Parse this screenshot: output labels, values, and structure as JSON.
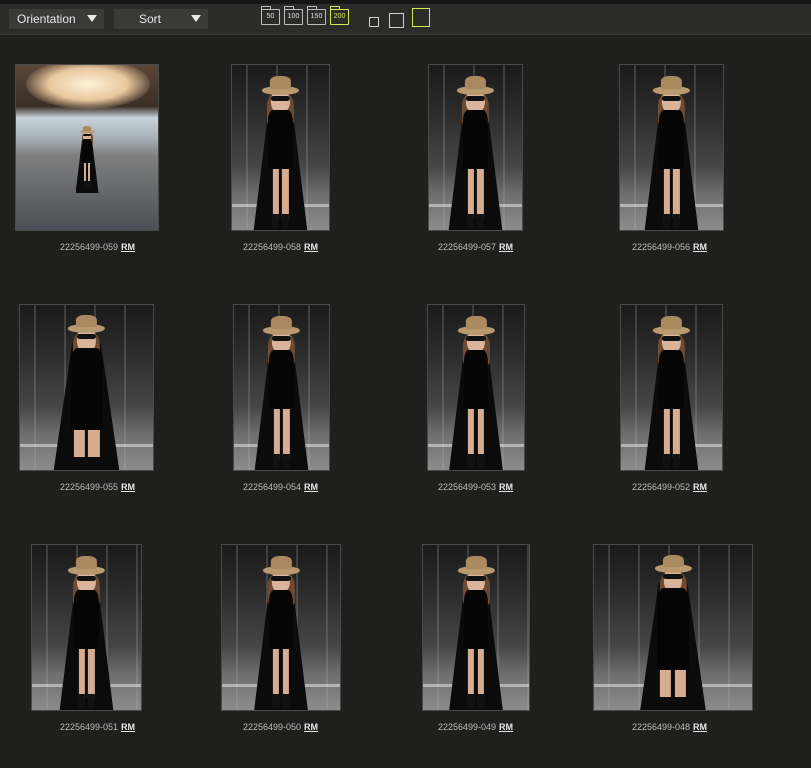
{
  "toolbar": {
    "orientation_label": "Orientation",
    "sort_label": "Sort",
    "sizes": [
      "50",
      "100",
      "150",
      "200"
    ],
    "active_size": "200",
    "accent_color": "#d7e84b"
  },
  "photos": [
    {
      "id": "22256499-059",
      "license": "RM",
      "scene": "canopy"
    },
    {
      "id": "22256499-058",
      "license": "RM",
      "scene": "terminal"
    },
    {
      "id": "22256499-057",
      "license": "RM",
      "scene": "terminal"
    },
    {
      "id": "22256499-056",
      "license": "RM",
      "scene": "terminal"
    },
    {
      "id": "22256499-055",
      "license": "RM",
      "scene": "closeup"
    },
    {
      "id": "22256499-054",
      "license": "RM",
      "scene": "terminal"
    },
    {
      "id": "22256499-053",
      "license": "RM",
      "scene": "terminal"
    },
    {
      "id": "22256499-052",
      "license": "RM",
      "scene": "terminal"
    },
    {
      "id": "22256499-051",
      "license": "RM",
      "scene": "terminal"
    },
    {
      "id": "22256499-050",
      "license": "RM",
      "scene": "terminal"
    },
    {
      "id": "22256499-049",
      "license": "RM",
      "scene": "terminal"
    },
    {
      "id": "22256499-048",
      "license": "RM",
      "scene": "closeup"
    }
  ]
}
